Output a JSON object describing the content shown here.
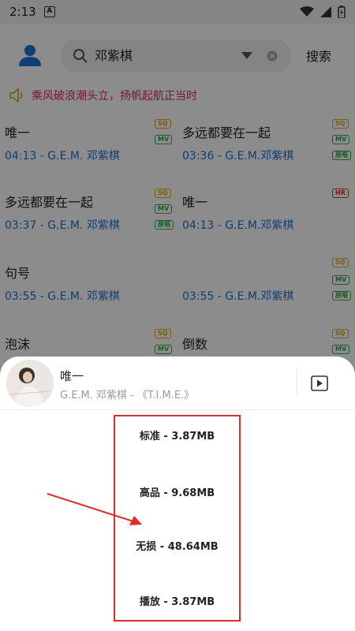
{
  "status_bar": {
    "time": "2:13",
    "a_label": "A"
  },
  "header": {
    "search_value": "邓紫棋",
    "search_button": "搜索"
  },
  "notice": "乘风破浪潮头立，扬帆起航正当时",
  "songs": [
    {
      "title": "唯一",
      "meta": "04:13 - G.E.M. 邓紫棋",
      "badges": [
        "SQ",
        "MV"
      ]
    },
    {
      "title": "多远都要在一起",
      "meta": "03:36 - G.E.M.邓紫棋",
      "badges": [
        "SQ",
        "MV",
        "原唱"
      ]
    },
    {
      "title": "多远都要在一起",
      "meta": "03:37 - G.E.M. 邓紫棋",
      "badges": [
        "SQ",
        "MV",
        "原唱"
      ]
    },
    {
      "title": "唯一",
      "meta": "04:13 - G.E.M.邓紫棋",
      "badges": [
        "HR"
      ]
    },
    {
      "title": "句号",
      "meta": "03:55 - G.E.M. 邓紫棋",
      "badges": []
    },
    {
      "title": "",
      "meta": "03:55 - G.E.M.邓紫棋",
      "badges": [
        "SQ",
        "MV",
        "原唱"
      ]
    },
    {
      "title": "泡沫",
      "meta": "",
      "badges": [
        "SQ",
        "MV"
      ]
    },
    {
      "title": "倒数",
      "meta": "",
      "badges": [
        "SQ",
        "MV"
      ]
    }
  ],
  "sheet": {
    "title": "唯一",
    "subtitle": "G.E.M. 邓紫棋 - 《T.I.M.E.》",
    "options": [
      "标准 - 3.87MB",
      "高品 - 9.68MB",
      "无损 - 48.64MB",
      "播放 - 3.87MB"
    ]
  },
  "colors": {
    "accent_red": "#e02b2b",
    "link_blue": "#1e6fd6",
    "notice_pink": "#e0245e"
  }
}
